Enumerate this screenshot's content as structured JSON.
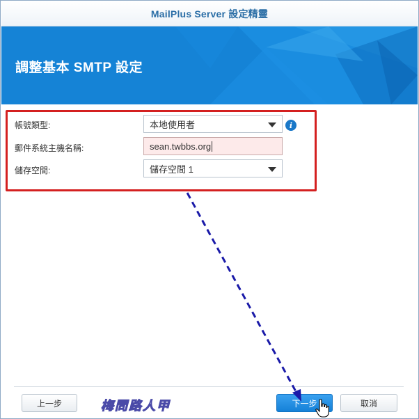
{
  "window": {
    "title": "MailPlus Server 設定精靈"
  },
  "banner": {
    "heading": "調整基本 SMTP 設定"
  },
  "form": {
    "account_type": {
      "label": "帳號類型:",
      "value": "本地使用者"
    },
    "hostname": {
      "label": "郵件系統主機名稱:",
      "value": "sean.twbbs.org"
    },
    "storage": {
      "label": "儲存空間:",
      "value": "儲存空間 1"
    },
    "info_icon_glyph": "i"
  },
  "footer": {
    "back_label": "上一步",
    "next_label": "下一步",
    "cancel_label": "取消",
    "watermark": "梅問路人甲"
  },
  "colors": {
    "banner": "#1583d6",
    "highlight": "#d42020",
    "arrow": "#1a1aa8",
    "primary_button": "#1581d8"
  }
}
